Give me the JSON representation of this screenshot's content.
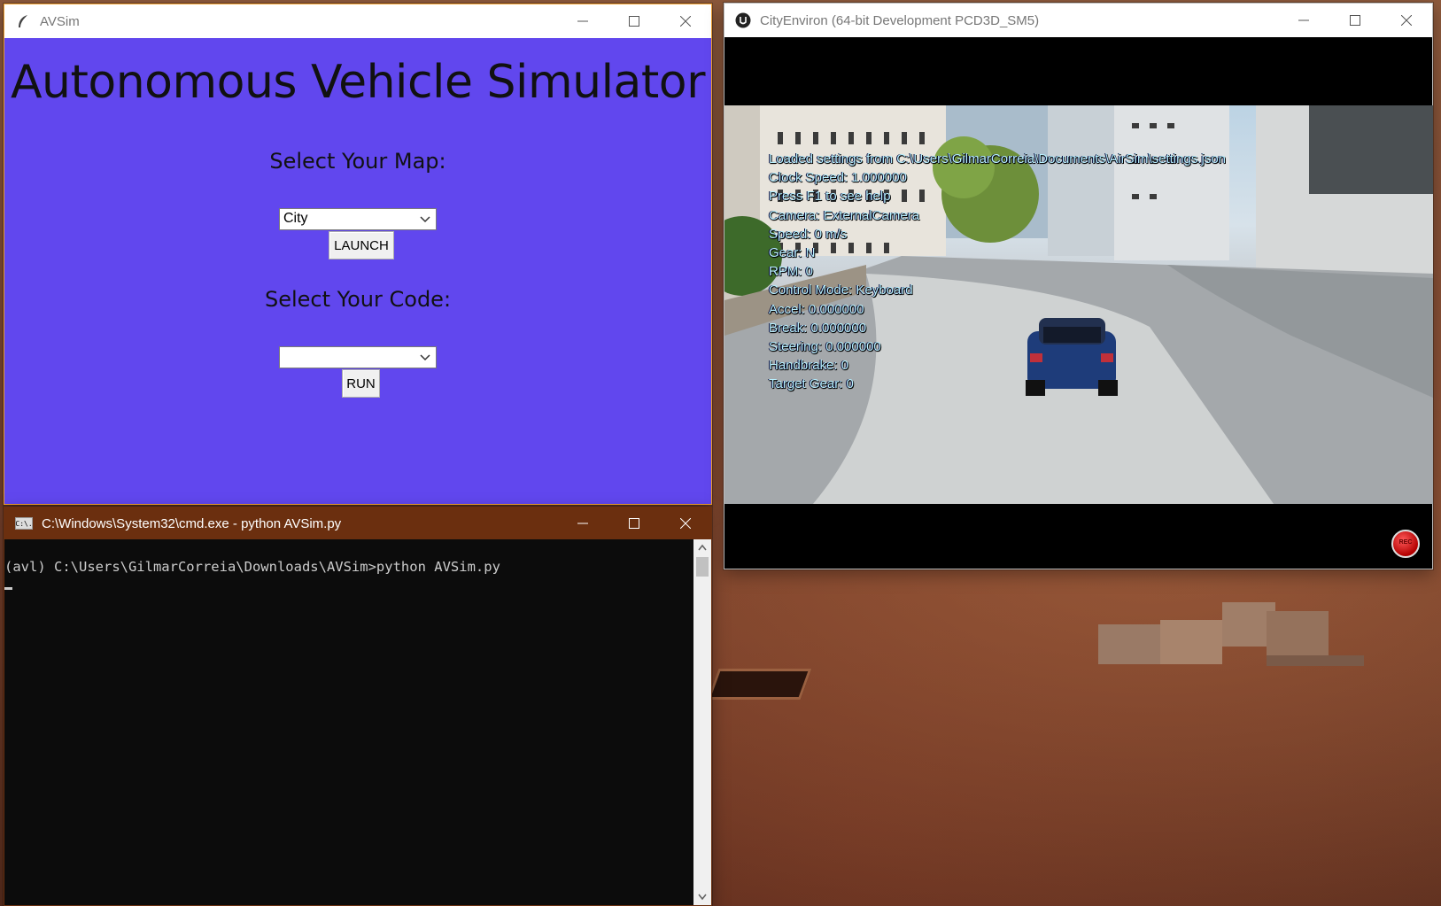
{
  "avsim_window": {
    "title": "AVSim",
    "heading": "Autonomous Vehicle Simulator",
    "map_label": "Select Your Map:",
    "map_selected": "City",
    "launch_label": "LAUNCH",
    "code_label": "Select Your Code:",
    "code_selected": "",
    "run_label": "RUN",
    "background_color": "#6147ee"
  },
  "city_window": {
    "title": "CityEnviron (64-bit Development PCD3D_SM5)",
    "hud_lines": [
      "Loaded settings from C:\\Users\\GilmarCorreia\\Documents\\AirSim\\settings.json",
      "Clock Speed: 1.000000",
      "Press F1 to see help",
      "Camera: ExternalCamera",
      "Speed: 0 m/s",
      "Gear: N",
      "RPM: 0",
      "Control Mode: Keyboard",
      "Accel: 0.000000",
      "Break: 0.000000",
      "Steering: 0.000000",
      "Handbrake: 0",
      "Target Gear: 0"
    ],
    "record_label": "REC"
  },
  "cmd_window": {
    "title": "C:\\Windows\\System32\\cmd.exe - python  AVSim.py",
    "icon_text": "C:\\.",
    "line1": "(avl) C:\\Users\\GilmarCorreia\\Downloads\\AVSim>python AVSim.py",
    "titlebar_color": "#6b2f0f"
  }
}
